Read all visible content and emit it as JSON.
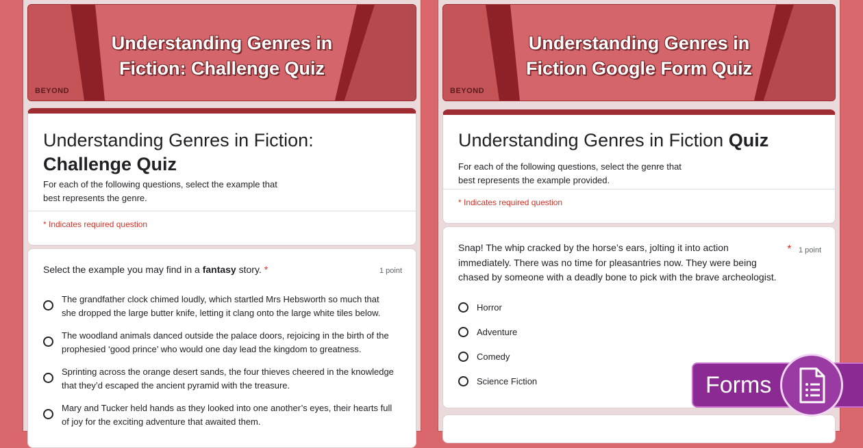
{
  "left": {
    "banner_line1": "Understanding Genres in",
    "banner_line2": "Fiction: Challenge Quiz",
    "brand": "BEYOND",
    "title_plain": "Understanding Genres in Fiction:",
    "title_bold": "Challenge Quiz",
    "description_line1": "For each of the following questions, select the example that",
    "description_line2": "best represents the genre.",
    "required_note": "* Indicates required question",
    "question": {
      "prefix": "Select the example you may find in a ",
      "bold": "fantasy",
      "suffix": " story.",
      "star": "*",
      "points": "1 point",
      "options": [
        {
          "line1": "The grandfather clock chimed loudly, which startled Mrs Hebsworth so much that",
          "line2": "she dropped the large butter knife, letting it clang onto the large white tiles below."
        },
        {
          "line1": "The woodland animals danced outside the palace doors, rejoicing in the birth of the",
          "line2": "prophesied ‘good prince’ who would one day lead the kingdom to greatness."
        },
        {
          "line1": "Sprinting across the orange desert sands, the four thieves cheered in the knowledge",
          "line2": "that they’d escaped the ancient pyramid with the treasure."
        },
        {
          "line1": "Mary and Tucker held hands as they looked into one another’s eyes, their hearts full",
          "line2": "of joy for the exciting adventure that awaited them."
        }
      ]
    }
  },
  "right": {
    "banner_line1": "Understanding Genres in",
    "banner_line2": "Fiction Google Form Quiz",
    "brand": "BEYOND",
    "title_plain": "Understanding Genres in Fiction ",
    "title_bold": "Quiz",
    "description_line1": "For each of the following questions, select the genre that",
    "description_line2": "best represents the example provided.",
    "required_note": "* Indicates required question",
    "question": {
      "line1": "Snap! The whip cracked by the horse’s ears, jolting it into action",
      "line2": "immediately. There was no time for pleasantries now. They were being",
      "line3": "chased by someone with a deadly bone to pick with the brave archeologist.",
      "star": "*",
      "points": "1 point",
      "options": [
        "Horror",
        "Adventure",
        "Comedy",
        "Science Fiction"
      ]
    }
  },
  "badge": {
    "label": "Forms",
    "icon": "google-forms-icon"
  },
  "colors": {
    "background": "#d9676b",
    "accent": "#9e2c31",
    "required": "#d93025",
    "badge": "#8a2a92"
  }
}
